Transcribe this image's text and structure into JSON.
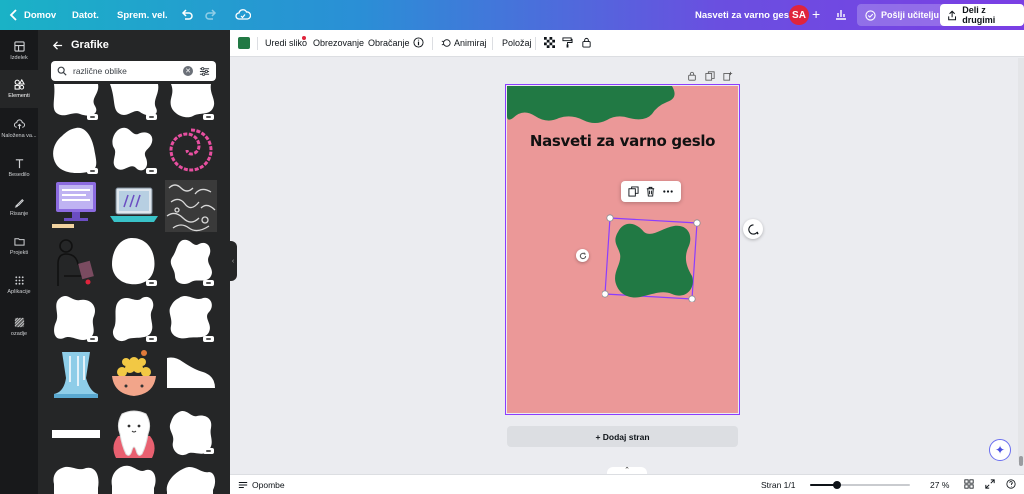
{
  "topbar": {
    "home": "Domov",
    "file": "Datot.",
    "saved": "Sprem. vel.",
    "doc_title": "Nasveti za varno geslo",
    "avatar_initials": "SA",
    "send_teacher": "Pošlji učitelju",
    "share": "Deli z drugimi"
  },
  "rail": {
    "items": [
      {
        "label": "Izdelek",
        "icon": "layout-icon"
      },
      {
        "label": "Elementi",
        "icon": "shapes-icon",
        "active": true
      },
      {
        "label": "Naložena va...",
        "icon": "upload-cloud-icon"
      },
      {
        "label": "Besedilo",
        "icon": "text-icon"
      },
      {
        "label": "Risanje",
        "icon": "draw-icon"
      },
      {
        "label": "Projekti",
        "icon": "folder-icon"
      },
      {
        "label": "Aplikacije",
        "icon": "apps-icon"
      },
      {
        "label": "ozadje",
        "icon": "pattern-icon"
      }
    ]
  },
  "panel": {
    "title": "Grafike",
    "search_value": "različne oblike"
  },
  "toolbar": {
    "color": "#217944",
    "edit_image": "Uredi sliko",
    "crop": "Obrezovanje",
    "flip": "Obračanje",
    "animate": "Animiraj",
    "position": "Položaj"
  },
  "canvas": {
    "page_bg": "#eb9898",
    "shape_color": "#217944",
    "title": "Nasveti za varno geslo",
    "add_page": "+ Dodaj stran"
  },
  "bottombar": {
    "notes": "Opombe",
    "page_indicator": "Stran 1/1",
    "zoom_fraction": 0.27,
    "zoom_label": "27 %"
  }
}
